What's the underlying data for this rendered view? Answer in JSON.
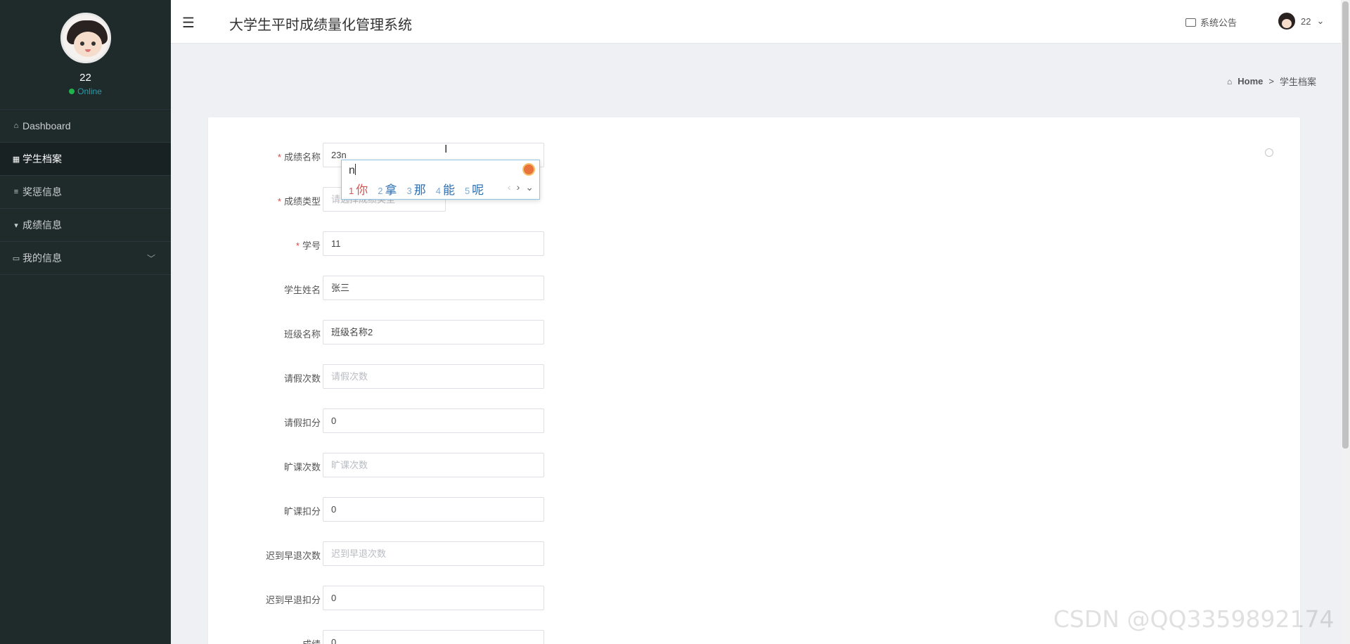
{
  "sidebar": {
    "username": "22",
    "status": "Online",
    "menu": [
      {
        "label": "Dashboard",
        "icon": "home-icon"
      },
      {
        "label": "学生档案",
        "icon": "grid-icon",
        "active": true
      },
      {
        "label": "奖惩信息",
        "icon": "sliders-icon"
      },
      {
        "label": "成绩信息",
        "icon": "filter-icon"
      },
      {
        "label": "我的信息",
        "icon": "card-icon",
        "expandable": true
      }
    ]
  },
  "header": {
    "menu_icon": "☰",
    "title": "大学生平时成绩量化管理系统",
    "notice_label": "系统公告",
    "user_label": "22"
  },
  "breadcrumb": {
    "home": "Home",
    "separator": ">",
    "current": "学生档案"
  },
  "form": {
    "fields": [
      {
        "label": "成绩名称",
        "required": true,
        "value": "23n",
        "placeholder": ""
      },
      {
        "label": "成绩类型",
        "required": true,
        "value": "",
        "placeholder": "请选择成绩类型",
        "type": "select"
      },
      {
        "label": "学号",
        "required": true,
        "value": "11",
        "placeholder": ""
      },
      {
        "label": "学生姓名",
        "required": false,
        "value": "张三",
        "placeholder": ""
      },
      {
        "label": "班级名称",
        "required": false,
        "value": "班级名称2",
        "placeholder": ""
      },
      {
        "label": "请假次数",
        "required": false,
        "value": "",
        "placeholder": "请假次数"
      },
      {
        "label": "请假扣分",
        "required": false,
        "value": "0",
        "placeholder": ""
      },
      {
        "label": "旷课次数",
        "required": false,
        "value": "",
        "placeholder": "旷课次数"
      },
      {
        "label": "旷课扣分",
        "required": false,
        "value": "0",
        "placeholder": ""
      },
      {
        "label": "迟到早退次数",
        "required": false,
        "value": "",
        "placeholder": "迟到早退次数"
      },
      {
        "label": "迟到早退扣分",
        "required": false,
        "value": "0",
        "placeholder": ""
      },
      {
        "label": "成绩",
        "required": false,
        "value": "0",
        "placeholder": ""
      }
    ]
  },
  "ime": {
    "composition": "n",
    "candidates": [
      {
        "num": "1",
        "text": "你"
      },
      {
        "num": "2",
        "text": "拿"
      },
      {
        "num": "3",
        "text": "那"
      },
      {
        "num": "4",
        "text": "能"
      },
      {
        "num": "5",
        "text": "呢"
      }
    ],
    "prev": "‹",
    "next": "›",
    "expand": "⌄"
  },
  "watermark": "CSDN @QQ3359892174",
  "colors": {
    "sidebar_bg": "#1f2a2a",
    "required_star": "#e64242",
    "online_dot": "#21b34b",
    "page_bg": "#eef0f4"
  }
}
